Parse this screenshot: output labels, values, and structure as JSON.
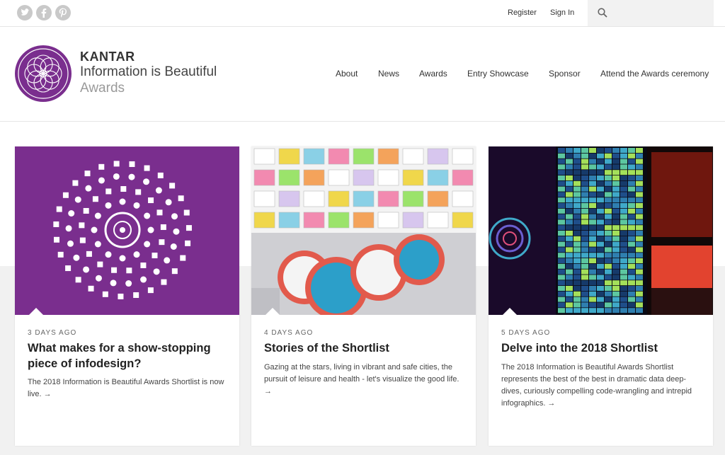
{
  "topbar": {
    "social": [
      "twitter-icon",
      "facebook-icon",
      "pinterest-icon"
    ],
    "register": "Register",
    "signin": "Sign In"
  },
  "brand": {
    "kantar": "KANTAR",
    "title": "Information is Beautiful",
    "subtitle": "Awards"
  },
  "nav": [
    "About",
    "News",
    "Awards",
    "Entry Showcase",
    "Sponsor",
    "Attend the Awards ceremony"
  ],
  "cards": [
    {
      "date": "3 DAYS AGO",
      "title": "What makes for a show-stopping piece of infodesign?",
      "excerpt": "The 2018 Information is Beautiful Awards Shortlist is now live. →"
    },
    {
      "date": "4 DAYS AGO",
      "title": "Stories of the Shortlist",
      "excerpt": "Gazing at the stars, living in vibrant and safe cities, the pursuit of leisure and health - let's visualize the good life. →"
    },
    {
      "date": "5 DAYS AGO",
      "title": "Delve into the 2018 Shortlist",
      "excerpt": "The 2018 Information is Beautiful Awards Shortlist represents the best of the best in dramatic data deep-dives, curiously compelling code-wrangling and intrepid infographics. →"
    }
  ],
  "colors": {
    "brand_purple": "#7a2e8e",
    "grey_band": "#f1f1f1"
  }
}
